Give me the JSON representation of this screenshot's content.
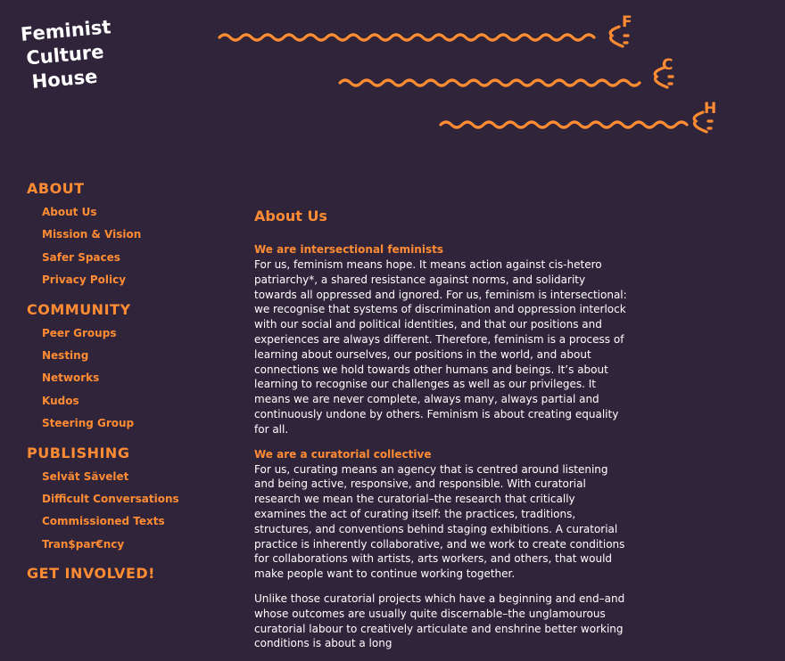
{
  "logo": {
    "line1": "Feminist",
    "line2": "Culture",
    "line3": "House"
  },
  "decor": {
    "letters": [
      "F",
      "C",
      "H"
    ],
    "color": "#ff8c33"
  },
  "nav": {
    "sections": [
      {
        "heading": "ABOUT",
        "items": [
          "About Us",
          "Mission & Vision",
          "Safer Spaces",
          "Privacy Policy"
        ]
      },
      {
        "heading": "COMMUNITY",
        "items": [
          "Peer Groups",
          "Nesting",
          "Networks",
          "Kudos",
          "Steering Group"
        ]
      },
      {
        "heading": "PUBLISHING",
        "items": [
          "Selvät Sävelet",
          "Difficult Conversations",
          "Commissioned Texts",
          "Tran$par€ncy"
        ]
      },
      {
        "heading": "GET INVOLVED!",
        "items": []
      }
    ]
  },
  "main": {
    "title": "About Us",
    "block1_heading": "We are intersectional feminists",
    "block1_text": "For us, feminism means hope. It means action against cis-hetero patriarchy*, a shared resistance against norms, and solidarity towards all oppressed and ignored. For us, feminism is intersectional: we recognise that systems of discrimination and oppression interlock with our social and political identities, and that our positions and experiences are always different. Therefore, feminism is a process of learning about ourselves, our positions in the world, and about connections we hold towards other humans and beings. It’s about learning to recognise our challenges as well as our privileges. It means we are never complete, always many, always partial and continuously undone by others. Feminism is about creating equality for all.",
    "block2_heading": "We are a curatorial collective",
    "block2_text": "For us, curating means an agency that is centred around listening and being active, responsive, and responsible. With curatorial research we mean the curatorial–the research that critically examines the act of curating itself: the practices, traditions, structures, and conventions behind staging exhibitions. A curatorial practice is inherently collaborative, and we work to create conditions for collaborations with artists, arts workers, and others, that would make people want to continue working together.",
    "block3_text": "Unlike those curatorial projects which have a beginning and end–and whose outcomes are usually quite discernable–the unglamourous curatorial labour to creatively articulate and enshrine better working conditions is about a long"
  }
}
